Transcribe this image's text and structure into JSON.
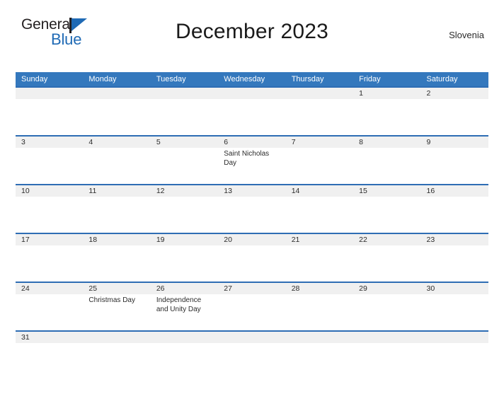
{
  "brand": {
    "name_part1": "General",
    "name_part2": "Blue",
    "flag_icon": "flag-triangle-icon",
    "accent_color": "#1f6ab5"
  },
  "header": {
    "title": "December 2023",
    "region": "Slovenia"
  },
  "colors": {
    "header_blue": "#3478bd",
    "row_border_blue": "#2e6db4",
    "date_strip_gray": "#f0f0f0",
    "text": "#2b2b2b"
  },
  "calendar": {
    "month": "December",
    "year": "2023",
    "weekdays": [
      "Sunday",
      "Monday",
      "Tuesday",
      "Wednesday",
      "Thursday",
      "Friday",
      "Saturday"
    ],
    "weeks": [
      {
        "days": [
          {
            "date": "",
            "event": ""
          },
          {
            "date": "",
            "event": ""
          },
          {
            "date": "",
            "event": ""
          },
          {
            "date": "",
            "event": ""
          },
          {
            "date": "",
            "event": ""
          },
          {
            "date": "1",
            "event": ""
          },
          {
            "date": "2",
            "event": ""
          }
        ]
      },
      {
        "days": [
          {
            "date": "3",
            "event": ""
          },
          {
            "date": "4",
            "event": ""
          },
          {
            "date": "5",
            "event": ""
          },
          {
            "date": "6",
            "event": "Saint Nicholas Day"
          },
          {
            "date": "7",
            "event": ""
          },
          {
            "date": "8",
            "event": ""
          },
          {
            "date": "9",
            "event": ""
          }
        ]
      },
      {
        "days": [
          {
            "date": "10",
            "event": ""
          },
          {
            "date": "11",
            "event": ""
          },
          {
            "date": "12",
            "event": ""
          },
          {
            "date": "13",
            "event": ""
          },
          {
            "date": "14",
            "event": ""
          },
          {
            "date": "15",
            "event": ""
          },
          {
            "date": "16",
            "event": ""
          }
        ]
      },
      {
        "days": [
          {
            "date": "17",
            "event": ""
          },
          {
            "date": "18",
            "event": ""
          },
          {
            "date": "19",
            "event": ""
          },
          {
            "date": "20",
            "event": ""
          },
          {
            "date": "21",
            "event": ""
          },
          {
            "date": "22",
            "event": ""
          },
          {
            "date": "23",
            "event": ""
          }
        ]
      },
      {
        "days": [
          {
            "date": "24",
            "event": ""
          },
          {
            "date": "25",
            "event": "Christmas Day"
          },
          {
            "date": "26",
            "event": "Independence and Unity Day"
          },
          {
            "date": "27",
            "event": ""
          },
          {
            "date": "28",
            "event": ""
          },
          {
            "date": "29",
            "event": ""
          },
          {
            "date": "30",
            "event": ""
          }
        ]
      },
      {
        "short": true,
        "days": [
          {
            "date": "31",
            "event": ""
          },
          {
            "date": "",
            "event": ""
          },
          {
            "date": "",
            "event": ""
          },
          {
            "date": "",
            "event": ""
          },
          {
            "date": "",
            "event": ""
          },
          {
            "date": "",
            "event": ""
          },
          {
            "date": "",
            "event": ""
          }
        ]
      }
    ]
  }
}
